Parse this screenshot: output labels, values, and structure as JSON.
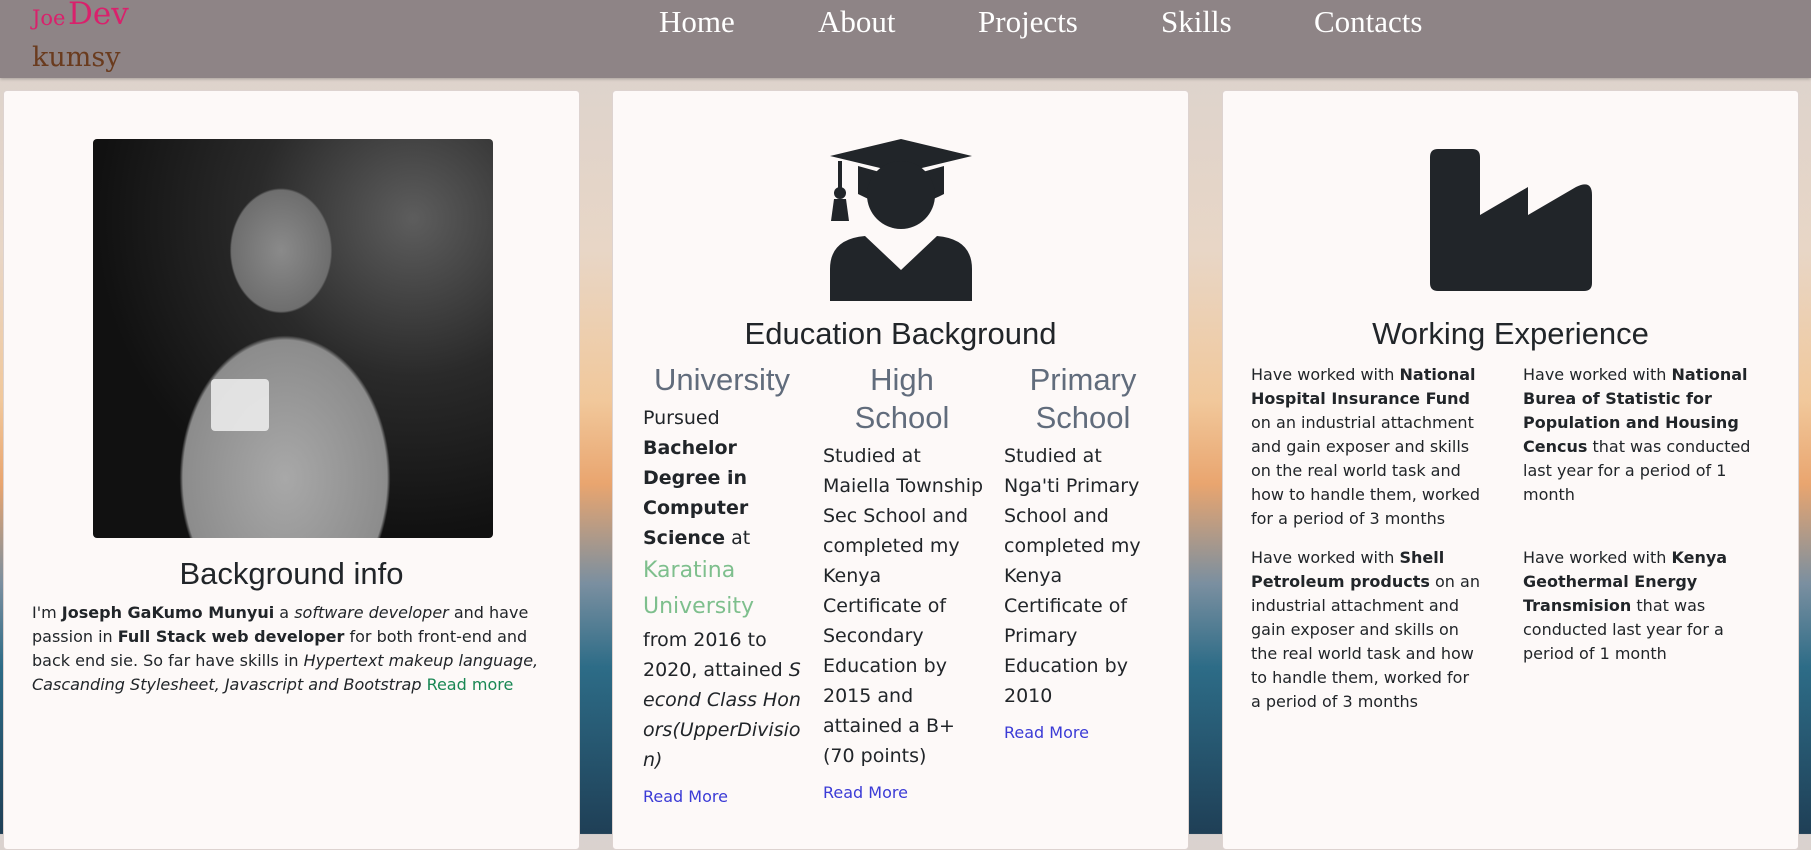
{
  "brand": {
    "part1": "Joe",
    "part2": "Dev",
    "part3": "kumsy"
  },
  "nav": [
    "Home",
    "About",
    "Projects",
    "Skills",
    "Contacts"
  ],
  "about": {
    "title": "Background info",
    "t1": "I'm ",
    "name": "Joseph GaKumo Munyui",
    "t2": " a ",
    "role": "software developer",
    "t3": " and have passion in ",
    "stack": "Full Stack web developer",
    "t4": " for both front-end and back end sie. So far have skills in ",
    "skills": "Hypertext makeup language, Cascanding Stylesheet, Javascript and Bootstrap",
    "read_more": "Read more"
  },
  "education": {
    "title": "Education Background",
    "read_more": "Read More",
    "university": {
      "heading": "University",
      "t1": "Pursued ",
      "degree": "Bachelor Degree in Computer Science",
      "t2": " at",
      "school": "Karatina University",
      "t3": "from 2016 to 2020, attained ",
      "grade": "Second Class Honors(UpperDivision)"
    },
    "high_school": {
      "heading": "High School",
      "text": "Studied at Maiella Township Sec School and completed my Kenya Certificate of Secondary Education by 2015 and attained a B+ (70 points)"
    },
    "primary": {
      "heading": "Primary School",
      "text": "Studied at Nga'ti Primary School and completed my Kenya Certificate of Primary Education by 2010"
    }
  },
  "work": {
    "title": "Working Experience",
    "items": [
      {
        "pre": "Have worked with ",
        "org": "National Hospital Insurance Fund",
        "post": " on an industrial attachment and gain exposer and skills on the real world task and how to handle them, worked for a period of 3 months"
      },
      {
        "pre": "Have worked with ",
        "org": "National Burea of Statistic for Population and Housing Cencus",
        "post": " that was conducted last year for a period of 1 month"
      },
      {
        "pre": "Have worked with ",
        "org": "Shell Petroleum products",
        "post": " on an industrial attachment and gain exposer and skills on the real world task and how to handle them, worked for a period of 3 months"
      },
      {
        "pre": "Have worked with ",
        "org": "Kenya Geothermal Energy Transmision",
        "post": " that was conducted last year for a period of 1 month"
      }
    ]
  },
  "icons": [
    "graduate-icon",
    "factory-icon"
  ],
  "colors": {
    "navbar": "#8e8486",
    "brand": "#d9216c",
    "brand_sub": "#6a3b1e",
    "card": "#fdf9f8",
    "heading_gray": "#616c7c",
    "link_green": "#198754",
    "link_blue": "#3b3bd6",
    "university_green": "#7ebf8d"
  }
}
